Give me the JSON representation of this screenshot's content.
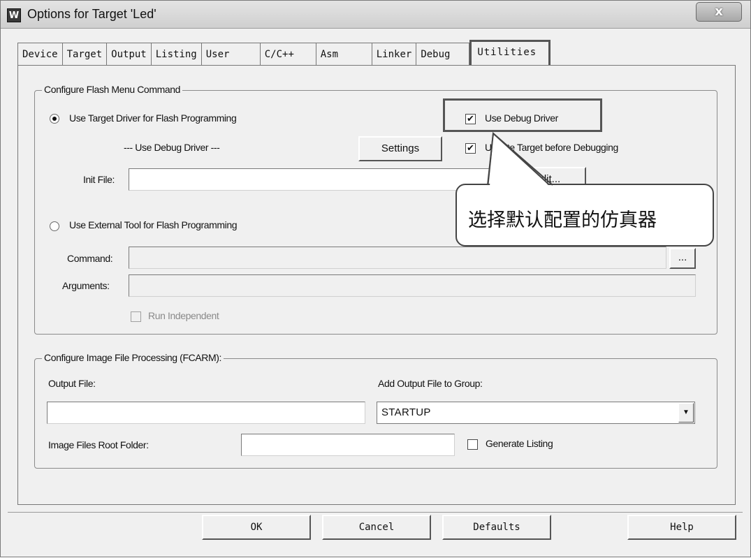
{
  "window": {
    "title": "Options for Target 'Led'",
    "icon_letter": "W",
    "close_glyph": "x"
  },
  "tabs": [
    {
      "label": "Device"
    },
    {
      "label": "Target"
    },
    {
      "label": "Output"
    },
    {
      "label": "Listing"
    },
    {
      "label": "User"
    },
    {
      "label": "C/C++"
    },
    {
      "label": "Asm"
    },
    {
      "label": "Linker"
    },
    {
      "label": "Debug"
    },
    {
      "label": "Utilities",
      "active": true
    }
  ],
  "flash": {
    "group_title": "Configure Flash Menu Command",
    "target_driver_label": "Use Target Driver for Flash Programming",
    "debug_driver_note": "--- Use Debug Driver ---",
    "settings_label": "Settings",
    "use_debug_driver_label": "Use Debug Driver",
    "update_target_label": "Update Target before Debugging",
    "init_file_label": "Init File:",
    "init_file_value": "",
    "edit_label": "Edit...",
    "external_tool_label": "Use External Tool for Flash Programming",
    "command_label": "Command:",
    "command_value": "",
    "browse_label": "...",
    "arguments_label": "Arguments:",
    "arguments_value": "",
    "run_independent_label": "Run Independent"
  },
  "image": {
    "group_title": "Configure Image File Processing (FCARM):",
    "output_file_label": "Output File:",
    "output_file_value": "",
    "add_group_label": "Add Output File  to Group:",
    "group_value": "STARTUP",
    "root_folder_label": "Image Files Root Folder:",
    "root_folder_value": "",
    "generate_listing_label": "Generate Listing"
  },
  "buttons": {
    "ok": "OK",
    "cancel": "Cancel",
    "defaults": "Defaults",
    "help": "Help"
  },
  "callout": {
    "text": "选择默认配置的仿真器"
  },
  "glyphs": {
    "check": "✔",
    "arrow": "▼"
  },
  "state": {
    "target_driver_selected": true,
    "external_tool_selected": false,
    "use_debug_driver_checked": true,
    "update_target_checked": true,
    "run_independent_checked": false,
    "generate_listing_checked": false
  }
}
